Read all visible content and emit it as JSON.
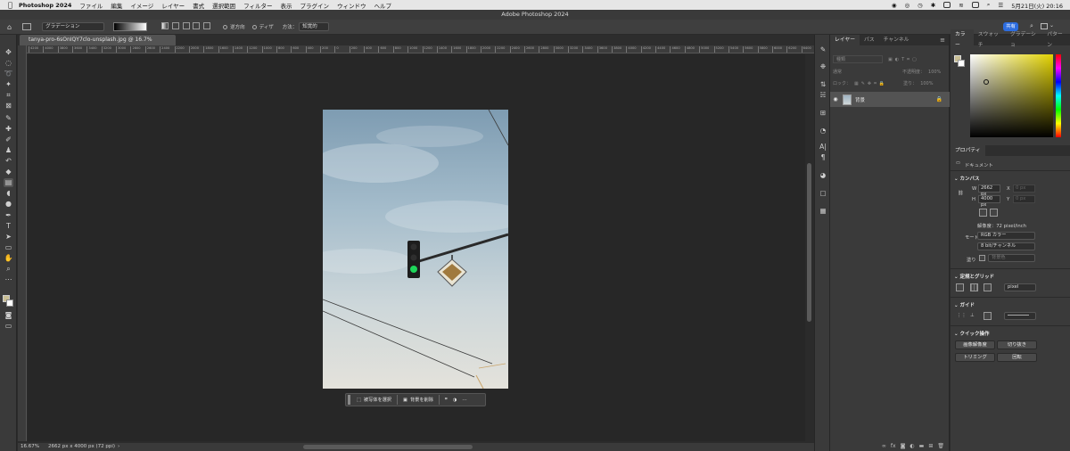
{
  "menubar": {
    "app_name": "Photoshop 2024",
    "items": [
      "ファイル",
      "編集",
      "イメージ",
      "レイヤー",
      "書式",
      "選択範囲",
      "フィルター",
      "表示",
      "プラグイン",
      "ウィンドウ",
      "ヘルプ"
    ],
    "clock": "5月21日(火) 20:16"
  },
  "window": {
    "title": "Adobe Photoshop 2024"
  },
  "options": {
    "preset": "グラデーション",
    "reverse": "逆方向",
    "dither": "ディザ",
    "method_label": "方法：",
    "method_value": "知覚的",
    "share": "共有"
  },
  "document": {
    "tab_title": "tanya-pro-6sOnIQY7clo-unsplash.jpg @ 16.7% (RGB/8*)",
    "ruler_ticks": [
      "4200",
      "4000",
      "3800",
      "3600",
      "3400",
      "3200",
      "3000",
      "2800",
      "2600",
      "2400",
      "2200",
      "2000",
      "1800",
      "1600",
      "1400",
      "1200",
      "1000",
      "800",
      "600",
      "400",
      "200",
      "0",
      "200",
      "400",
      "600",
      "800",
      "1000",
      "1200",
      "1400",
      "1600",
      "1800",
      "2000",
      "2200",
      "2400",
      "2600",
      "2800",
      "3000",
      "3200",
      "3400",
      "3600",
      "3800",
      "4000",
      "4200",
      "4400",
      "4600",
      "4800",
      "5000",
      "5200",
      "5400",
      "5600",
      "5800",
      "6000",
      "6200",
      "6400"
    ]
  },
  "context_bar": {
    "select_subject": "被写体を選択",
    "remove_bg": "背景を削除"
  },
  "status": {
    "zoom": "16.67%",
    "info": "2662 px x 4000 px (72 ppi)"
  },
  "layers_panel": {
    "tabs": [
      "レイヤー",
      "パス",
      "チャンネル"
    ],
    "search": "種類",
    "blend_mode": "通常",
    "opacity_label": "不透明度：",
    "opacity_value": "100%",
    "lock_label": "ロック：",
    "fill_label": "塗り：",
    "fill_value": "100%",
    "layer_name": "背景"
  },
  "color_panel": {
    "tabs": [
      "カラー",
      "スウォッチ",
      "グラデーショ",
      "パターン"
    ]
  },
  "properties": {
    "tab": "プロパティ",
    "doc_label": "ドキュメント",
    "canvas_section": "カンバス",
    "w_label": "W",
    "w_value": "2662 px",
    "h_label": "H",
    "h_value": "4000 px",
    "x_label": "X",
    "x_value": "0 px",
    "y_label": "Y",
    "y_value": "0 px",
    "resolution": "解像度：72 pixel/inch",
    "mode_label": "モード",
    "mode_value": "RGB カラー",
    "bits_value": "8 bit/チャンネル",
    "fill_label": "塗り",
    "fill_value": "背景色",
    "rulers_section": "定規とグリッド",
    "ruler_unit": "pixel",
    "guides_section": "ガイド",
    "quick_section": "クイック操作",
    "btn_image_size": "画像解像度",
    "btn_crop": "切り抜き",
    "btn_trim": "トリミング",
    "btn_rotate": "回転"
  },
  "colors": {
    "accent": "#2d6de0",
    "foreground": "#c9bf94",
    "background": "#ffffff"
  }
}
